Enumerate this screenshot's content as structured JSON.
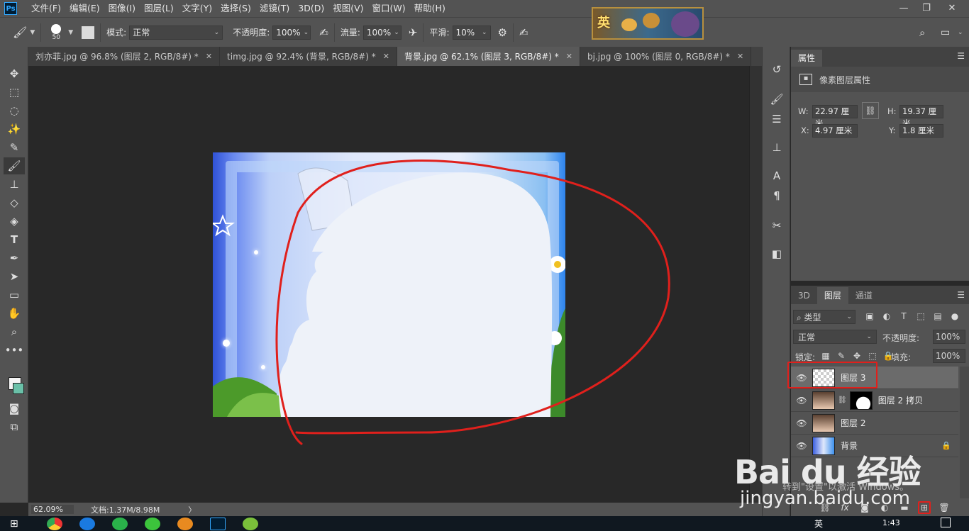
{
  "app": {
    "logo": "Ps",
    "banner_text": "英"
  },
  "menu": [
    "文件(F)",
    "编辑(E)",
    "图像(I)",
    "图层(L)",
    "文字(Y)",
    "选择(S)",
    "滤镜(T)",
    "3D(D)",
    "视图(V)",
    "窗口(W)",
    "帮助(H)"
  ],
  "window_controls": {
    "minimize": "—",
    "restore": "❐",
    "close": "✕"
  },
  "options": {
    "brush_size": "50",
    "mode_label": "模式:",
    "mode_value": "正常",
    "opacity_label": "不透明度:",
    "opacity_value": "100%",
    "flow_label": "流量:",
    "flow_value": "100%",
    "smooth_label": "平滑:",
    "smooth_value": "10%"
  },
  "tabs": [
    {
      "label": "刘亦菲.jpg @ 96.8% (图层 2, RGB/8#) *",
      "active": false
    },
    {
      "label": "timg.jpg @ 92.4% (背景, RGB/8#) *",
      "active": false
    },
    {
      "label": "背景.jpg @ 62.1% (图层 3, RGB/8#) *",
      "active": true
    },
    {
      "label": "bj.jpg @ 100% (图层 0, RGB/8#) *",
      "active": false
    }
  ],
  "status": {
    "zoom": "62.09%",
    "doc_info": "文档:1.37M/8.98M",
    "arrow": "〉"
  },
  "properties": {
    "tab": "属性",
    "title": "像素图层属性",
    "w_label": "W:",
    "w_value": "22.97 厘米",
    "h_label": "H:",
    "h_value": "19.37 厘米",
    "x_label": "X:",
    "x_value": "4.97 厘米",
    "y_label": "Y:",
    "y_value": "1.8 厘米"
  },
  "layers_panel": {
    "tabs": [
      "3D",
      "图层",
      "通道"
    ],
    "filter_value": "类型",
    "blend_value": "正常",
    "opacity_label": "不透明度:",
    "opacity_value": "100%",
    "lock_label": "锁定:",
    "fill_label": "填充:",
    "fill_value": "100%",
    "layers": [
      {
        "name": "图层 3",
        "selected": true
      },
      {
        "name": "图层 2 拷贝",
        "selected": false
      },
      {
        "name": "图层 2",
        "selected": false
      },
      {
        "name": "背景",
        "selected": false
      }
    ],
    "bottom_fx": "fx"
  },
  "watermark": {
    "logo": "Bai du 经验",
    "url": "jingyan.baidu.com"
  },
  "activation_text": "转到\"设置\"以激活 Windows。",
  "taskbar": {
    "time": "1:43",
    "lang": "英"
  },
  "colors": {
    "accent": "#31a8ff",
    "highlight": "#e0201c",
    "panel": "#535353"
  }
}
